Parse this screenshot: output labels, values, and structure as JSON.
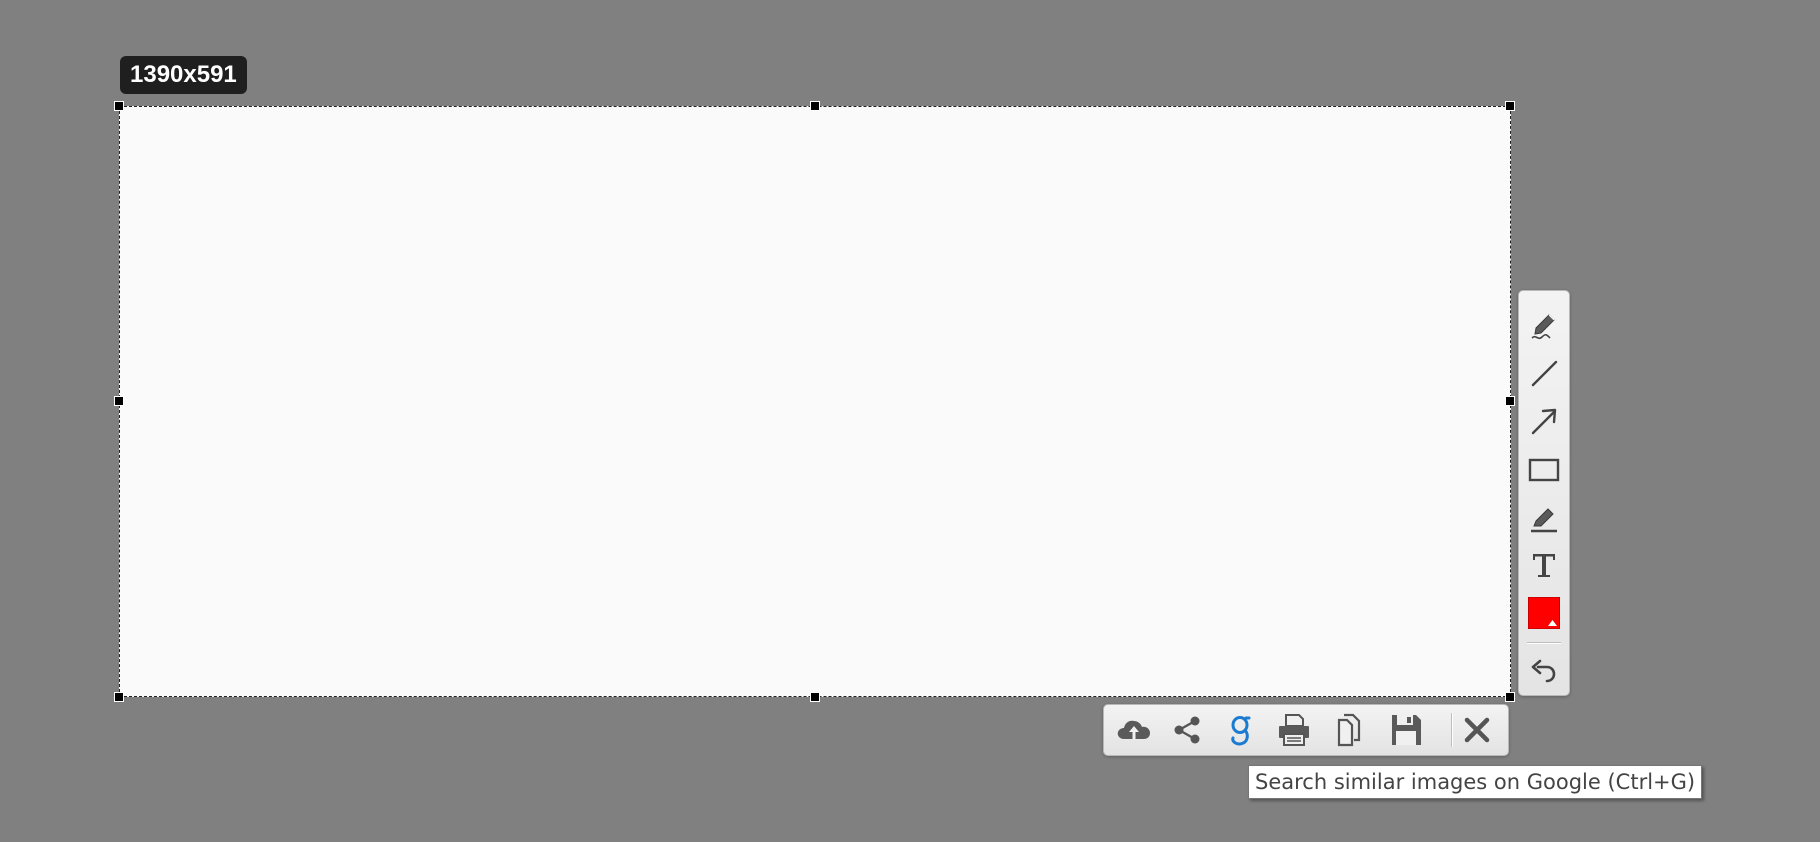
{
  "selection": {
    "size_label": "1390x591"
  },
  "tool_palette": {
    "tools": [
      {
        "icon": "pencil-icon"
      },
      {
        "icon": "line-icon"
      },
      {
        "icon": "arrow-icon"
      },
      {
        "icon": "rectangle-icon"
      },
      {
        "icon": "highlighter-icon"
      },
      {
        "icon": "text-icon"
      },
      {
        "icon": "color-picker",
        "color": "#ff0000"
      },
      {
        "icon": "undo-icon"
      }
    ]
  },
  "action_bar": {
    "actions": [
      {
        "icon": "cloud-upload-icon"
      },
      {
        "icon": "share-icon"
      },
      {
        "icon": "google-search-icon",
        "color": "#1a7bd1"
      },
      {
        "icon": "print-icon"
      },
      {
        "icon": "copy-icon"
      },
      {
        "icon": "save-icon"
      },
      {
        "icon": "close-icon"
      }
    ]
  },
  "tooltip": {
    "text": "Search similar images on Google (Ctrl+G)"
  }
}
